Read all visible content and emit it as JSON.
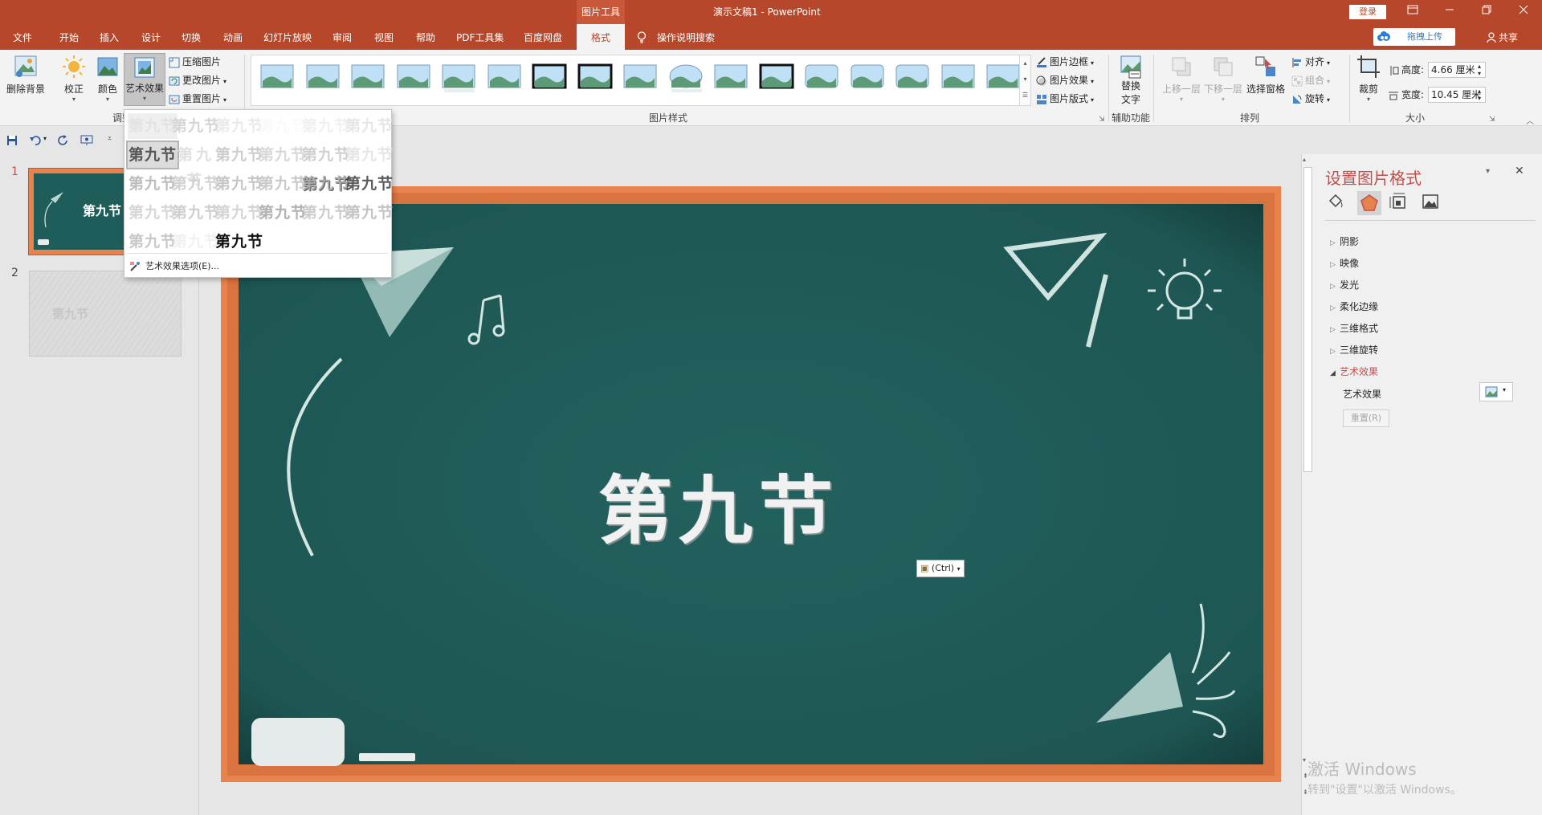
{
  "titlebar": {
    "context_tab": "图片工具",
    "document_title": "演示文稿1  -  PowerPoint",
    "login": "登录"
  },
  "tabs": [
    {
      "label": "文件"
    },
    {
      "label": "开始"
    },
    {
      "label": "插入"
    },
    {
      "label": "设计"
    },
    {
      "label": "切换"
    },
    {
      "label": "动画"
    },
    {
      "label": "幻灯片放映"
    },
    {
      "label": "审阅"
    },
    {
      "label": "视图"
    },
    {
      "label": "帮助"
    },
    {
      "label": "PDF工具集"
    },
    {
      "label": "百度网盘"
    },
    {
      "label": "格式",
      "active": true
    }
  ],
  "tell_me": "操作说明搜索",
  "upload_button": "拖拽上传",
  "share": "共享",
  "ribbon": {
    "remove_bg": "删除背景",
    "corrections": "校正",
    "color": "颜色",
    "artistic_effects": "艺术效果",
    "compress": "压缩图片",
    "change_picture": "更改图片",
    "reset_picture": "重置图片",
    "adjust_group": "调整",
    "picture_border": "图片边框",
    "picture_effects": "图片效果",
    "picture_layout": "图片版式",
    "picture_styles_group": "图片样式",
    "alt_text_line1": "替换",
    "alt_text_line2": "文字",
    "accessibility_group": "辅助功能",
    "bring_forward": "上移一层",
    "send_backward": "下移一层",
    "selection_pane": "选择窗格",
    "align": "对齐",
    "group": "组合",
    "rotate": "旋转",
    "arrange_group": "排列",
    "crop": "裁剪",
    "height_label": "高度:",
    "height_value": "4.66 厘米",
    "width_label": "宽度:",
    "width_value": "10.45 厘米",
    "size_group": "大小"
  },
  "dropdown": {
    "effect_text": "第九节",
    "options_link": "艺术效果选项(E)..."
  },
  "slides": [
    {
      "number": "1",
      "title": "第九节"
    },
    {
      "number": "2",
      "title": "第九节"
    }
  ],
  "slide": {
    "title": "第九节",
    "paste_tag": "(Ctrl)"
  },
  "pane": {
    "title": "设置图片格式",
    "sections": [
      {
        "label": "阴影",
        "expanded": false
      },
      {
        "label": "映像",
        "expanded": false
      },
      {
        "label": "发光",
        "expanded": false
      },
      {
        "label": "柔化边缘",
        "expanded": false
      },
      {
        "label": "三维格式",
        "expanded": false
      },
      {
        "label": "三维旋转",
        "expanded": false
      },
      {
        "label": "艺术效果",
        "expanded": true
      }
    ],
    "artistic_label": "艺术效果",
    "reset_button": "重置(R)"
  },
  "watermark": {
    "line1": "激活 Windows",
    "line2": "转到\"设置\"以激活 Windows。"
  },
  "colors": {
    "accent": "#b7472a",
    "board": "#1f5d5b",
    "frame": "#e8834e"
  }
}
